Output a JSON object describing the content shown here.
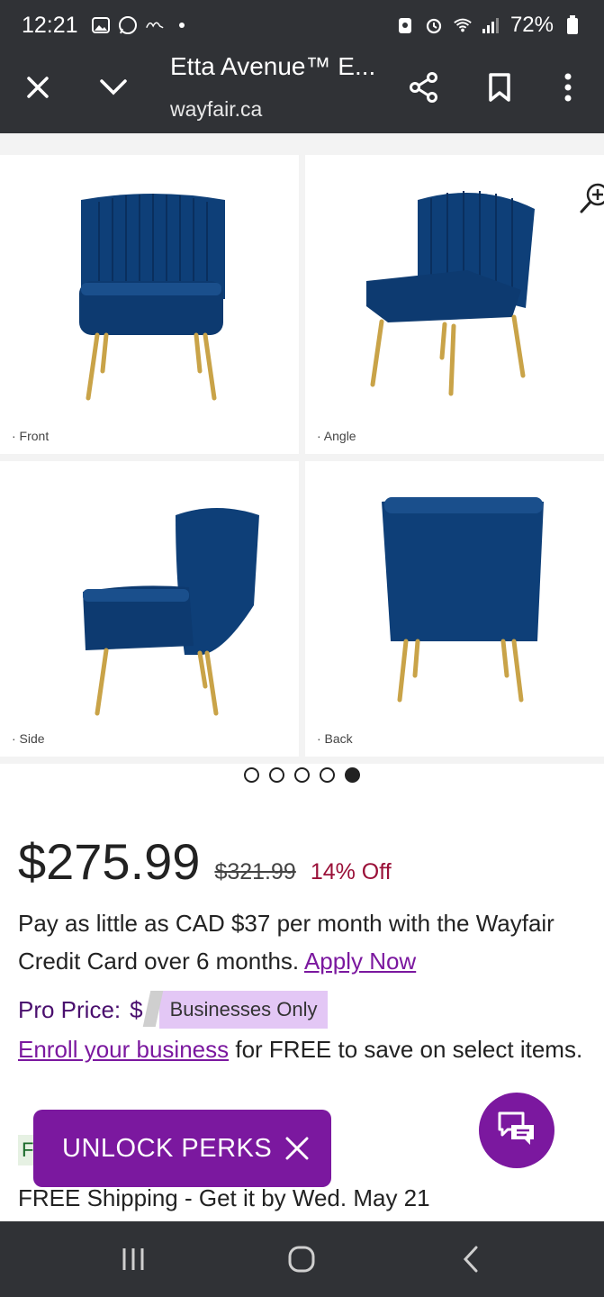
{
  "status_bar": {
    "time": "12:21",
    "battery": "72%"
  },
  "browser": {
    "title": "Etta Avenue™ E...",
    "url": "wayfair.ca"
  },
  "gallery": {
    "captions": [
      "· Front",
      "· Angle",
      "· Side",
      "· Back"
    ],
    "dots_total": 5,
    "dots_active_index": 4
  },
  "pricing": {
    "price": "$275.99",
    "original": "$321.99",
    "discount": "14% Off",
    "credit_text": "Pay as little as CAD $37 per month with the Wayfair Credit Card over 6 months.",
    "apply_link": "Apply Now",
    "pro_label": "Pro Price:",
    "pro_value": "$",
    "business_badge": "Businesses Only",
    "enroll_link": "Enroll your business",
    "enroll_text": "for FREE to save on select items.",
    "ship_badge": "F",
    "shipping": "FREE Shipping - Get it by Wed. May 21"
  },
  "perks": {
    "label": "UNLOCK PERKS"
  },
  "colors": {
    "accent": "#7b189f",
    "discount": "#9a1038",
    "bars": "#303236"
  },
  "icons": [
    "close-icon",
    "chevron-down-icon",
    "share-icon",
    "bookmark-icon",
    "more-vert-icon",
    "zoom-in-icon",
    "chat-icon",
    "recents-icon",
    "home-icon",
    "back-icon"
  ]
}
